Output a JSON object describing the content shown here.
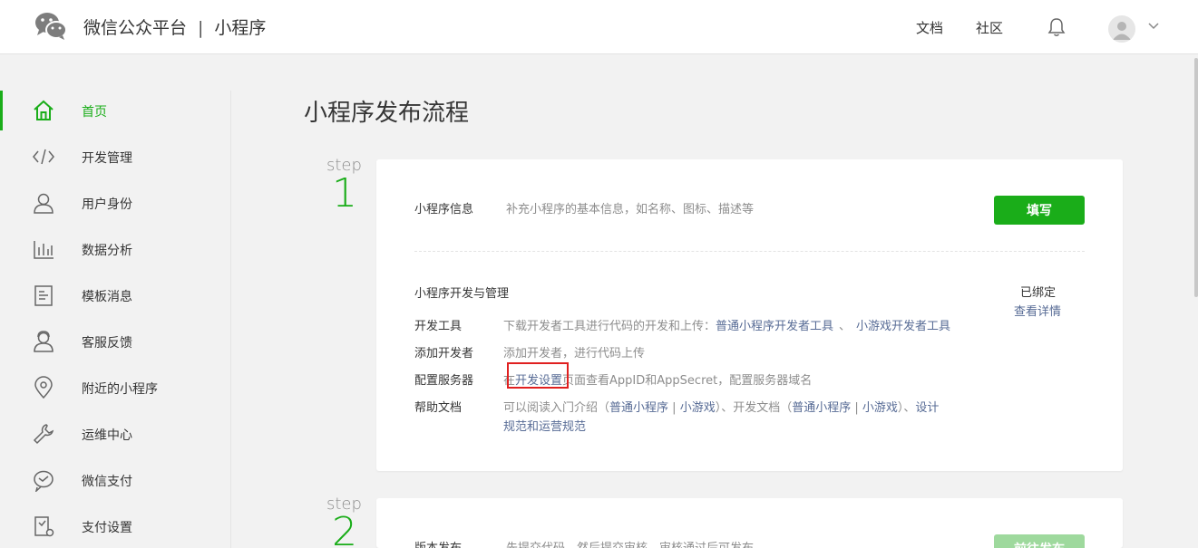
{
  "header": {
    "platform_name": "微信公众平台",
    "separator": "|",
    "product_name": "小程序",
    "links": [
      "文档",
      "社区"
    ],
    "icons": {
      "logo": "wechat-logo-icon",
      "bell": "bell-icon",
      "avatar": "user-avatar-icon",
      "caret": "chevron-down-icon"
    }
  },
  "sidebar": {
    "accent": "#1aad19",
    "items": [
      {
        "label": "首页",
        "icon": "home-icon",
        "active": true
      },
      {
        "label": "开发管理",
        "icon": "code-icon"
      },
      {
        "label": "用户身份",
        "icon": "user-icon"
      },
      {
        "label": "数据分析",
        "icon": "bar-chart-icon"
      },
      {
        "label": "模板消息",
        "icon": "document-icon"
      },
      {
        "label": "客服反馈",
        "icon": "customer-service-icon"
      },
      {
        "label": "附近的小程序",
        "icon": "location-pin-icon"
      },
      {
        "label": "运维中心",
        "icon": "wrench-icon"
      },
      {
        "label": "微信支付",
        "icon": "payment-icon"
      },
      {
        "label": "支付设置",
        "icon": "payment-settings-icon"
      }
    ]
  },
  "main": {
    "title": "小程序发布流程",
    "step_word": "step",
    "steps": [
      {
        "number": "1",
        "info": {
          "label": "小程序信息",
          "desc": "补充小程序的基本信息，如名称、图标、描述等",
          "button": "填写"
        },
        "dev": {
          "heading": "小程序开发与管理",
          "status": "已绑定",
          "status_link": "查看详情",
          "rows": [
            {
              "label": "开发工具",
              "desc": "下载开发者工具进行代码的开发和上传：",
              "link1": "普通小程序开发者工具",
              "sep": "、",
              "link2": "小游戏开发者工具"
            },
            {
              "label": "添加开发者",
              "desc": "添加开发者，进行代码上传"
            },
            {
              "label": "配置服务器",
              "prefix": "在",
              "link": "开发设置",
              "suffix": "页面查看AppID和AppSecret，配置服务器域名"
            },
            {
              "label": "帮助文档",
              "parts": [
                "可以阅读入门介绍（",
                "普通小程序",
                " | ",
                "小游戏",
                "）、开发文档（",
                "普通小程序",
                " | ",
                "小游戏",
                "）、",
                "设计"
              ],
              "line2": "规范和运营规范"
            }
          ]
        }
      },
      {
        "number": "2",
        "label": "版本发布",
        "desc": "先提交代码，然后提交审核，审核通过后可发布",
        "button": "前往发布"
      }
    ]
  }
}
